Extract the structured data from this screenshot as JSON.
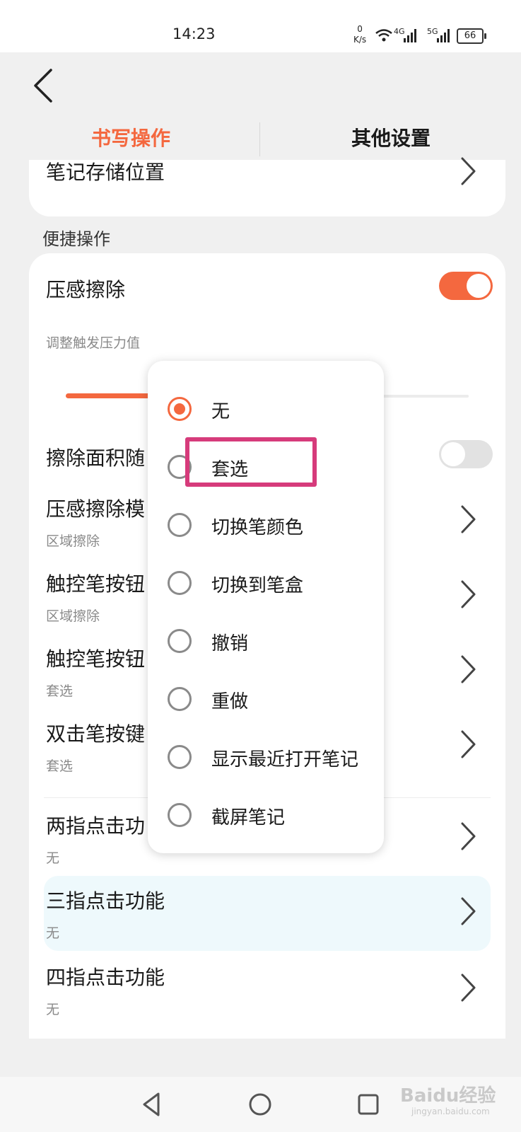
{
  "status_bar": {
    "time": "14:23",
    "speed_value": "0",
    "speed_unit": "K/s",
    "net_4g": "4G",
    "net_5g": "5G",
    "battery": "66"
  },
  "header": {
    "back_icon": "chevron-left-icon",
    "tabs": [
      {
        "label": "书写操作",
        "active": true
      },
      {
        "label": "其他设置",
        "active": false
      }
    ]
  },
  "top_card": {
    "item_label": "笔记存储位置"
  },
  "section": {
    "label": "便捷操作"
  },
  "settings": {
    "pressure_erase": {
      "label": "压感擦除",
      "enabled": true
    },
    "trigger_pressure": {
      "label": "调整触发压力值",
      "level_fraction": 0.2
    },
    "erase_area": {
      "label": "擦除面积随",
      "enabled": false
    },
    "items": [
      {
        "label": "压感擦除模",
        "value": "区域擦除"
      },
      {
        "label": "触控笔按钮",
        "value": "区域擦除"
      },
      {
        "label": "触控笔按钮",
        "value": "套选"
      },
      {
        "label": "双击笔按键",
        "value": "套选"
      },
      {
        "label": "两指点击功",
        "value": "无"
      },
      {
        "label": "三指点击功能",
        "value": "无"
      },
      {
        "label": "四指点击功能",
        "value": "无"
      }
    ]
  },
  "popup": {
    "options": [
      {
        "label": "无",
        "selected": true
      },
      {
        "label": "套选",
        "selected": false
      },
      {
        "label": "切换笔颜色",
        "selected": false
      },
      {
        "label": "切换到笔盒",
        "selected": false
      },
      {
        "label": "撤销",
        "selected": false
      },
      {
        "label": "重做",
        "selected": false
      },
      {
        "label": "显示最近打开笔记",
        "selected": false
      },
      {
        "label": "截屏笔记",
        "selected": false
      }
    ]
  },
  "watermark": {
    "brand": "Baidu经验",
    "url": "jingyan.baidu.com"
  },
  "colors": {
    "accent": "#f4683f",
    "annotation": "#d63b7b",
    "highlight_row": "#eef9fc"
  }
}
